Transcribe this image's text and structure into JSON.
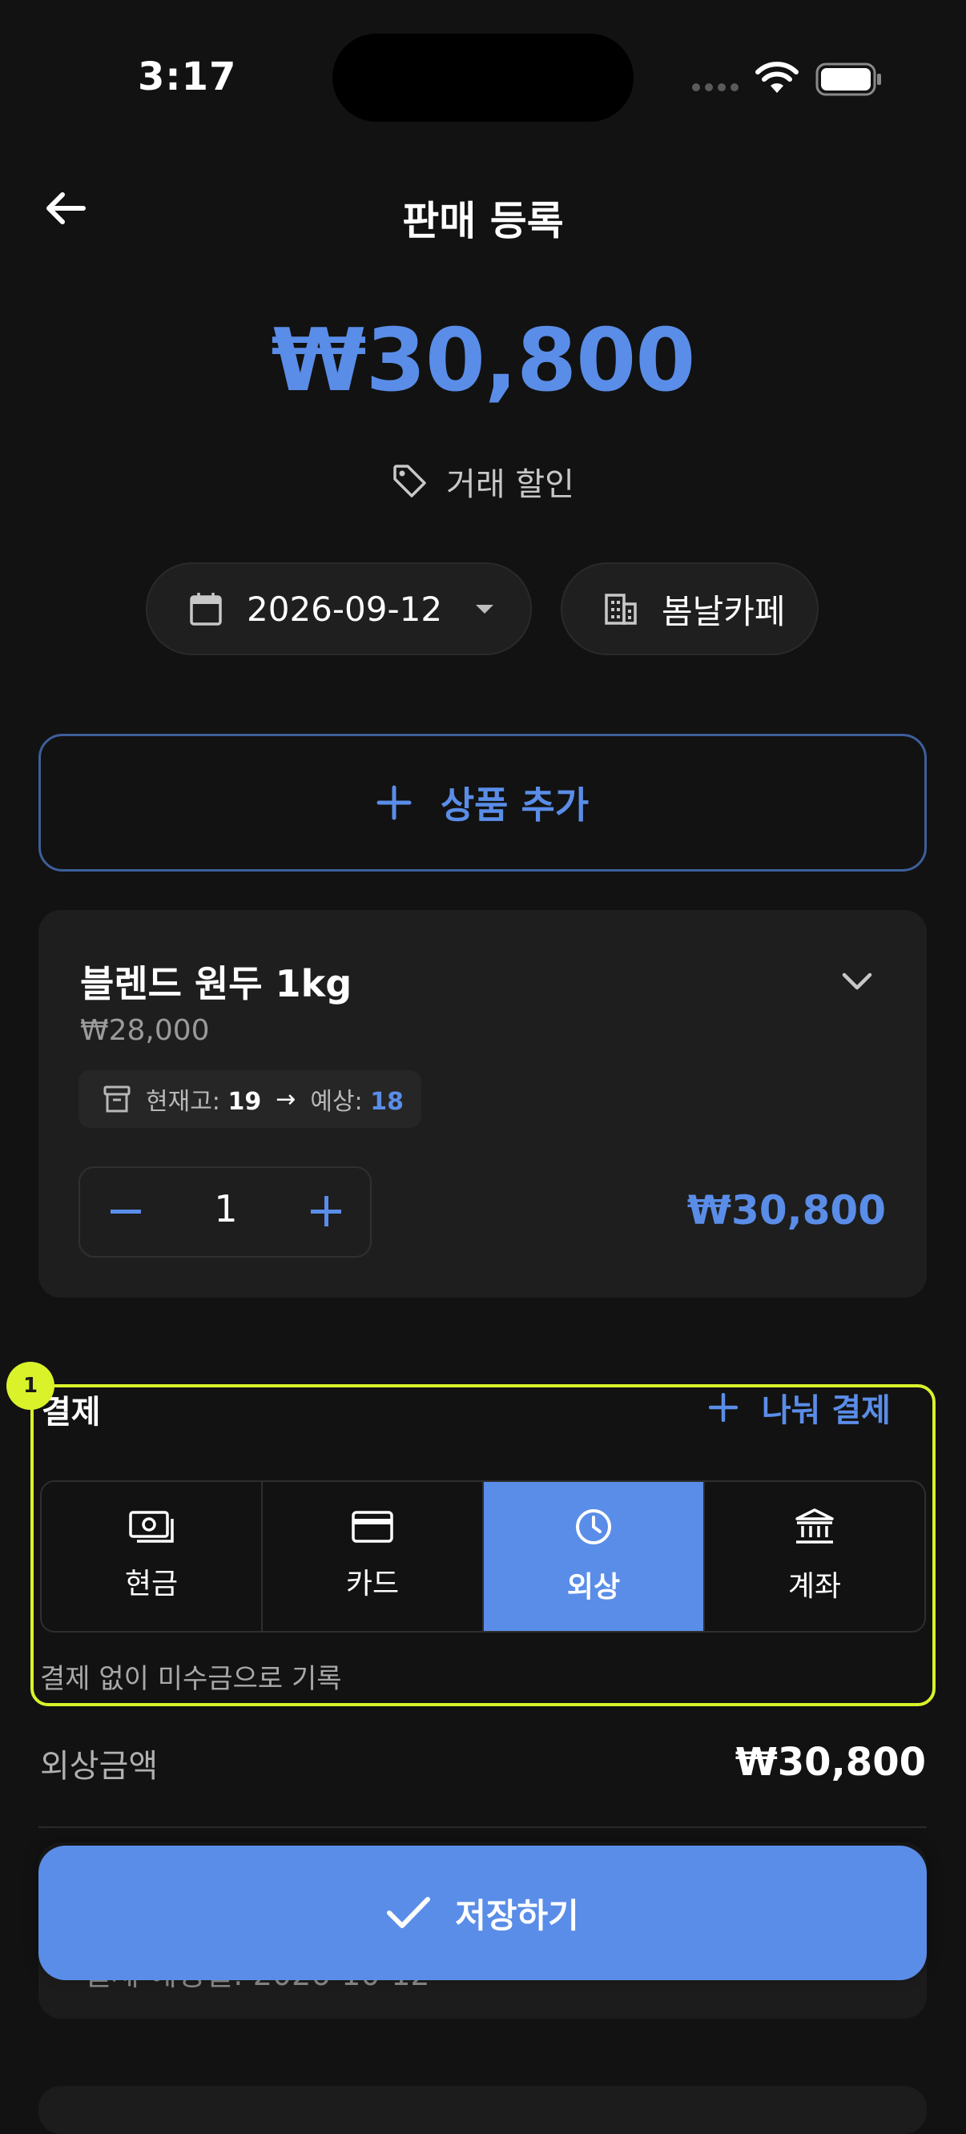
{
  "status_bar": {
    "time": "3:17"
  },
  "header": {
    "title": "판매 등록"
  },
  "summary": {
    "total": "₩30,800",
    "discount_label": "거래 할인"
  },
  "filters": {
    "date": "2026-09-12",
    "store": "봄날카페"
  },
  "add_product": {
    "label": "상품 추가"
  },
  "product": {
    "name": "블렌드 원두 1kg",
    "unit_price": "₩28,000",
    "stock_label": "현재고:",
    "stock_current": "19",
    "stock_arrow": "→",
    "expected_label": "예상:",
    "stock_expected": "18",
    "quantity": "1",
    "line_total": "₩30,800"
  },
  "payment": {
    "section_label": "결제",
    "split_label": "나눠 결제",
    "methods": [
      {
        "label": "현금",
        "icon": "cash-icon",
        "active": false
      },
      {
        "label": "카드",
        "icon": "card-icon",
        "active": false
      },
      {
        "label": "외상",
        "icon": "clock-icon",
        "active": true
      },
      {
        "label": "계좌",
        "icon": "bank-icon",
        "active": false
      }
    ],
    "note": "결제 없이 미수금으로 기록",
    "annotation_badge": "1"
  },
  "credit": {
    "label": "외상금액",
    "amount": "₩30,800",
    "due_text": "결제 예정일: 2026-10-12"
  },
  "save_button": {
    "label": "저장하기"
  },
  "colors": {
    "accent": "#5a8de8",
    "background": "#121212",
    "highlight": "#d9f22a"
  }
}
